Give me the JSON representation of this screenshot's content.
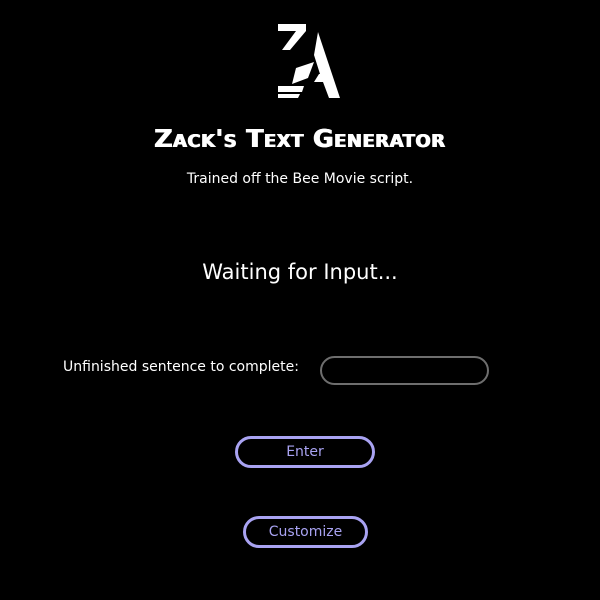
{
  "header": {
    "logo_icon": "za-monogram-logo",
    "title": "Zack's Text Generator",
    "subtitle": "Trained off the Bee Movie script."
  },
  "main": {
    "status": "Waiting for Input...",
    "prompt_label": "Unfinished sentence to complete:",
    "prompt_value": "",
    "enter_label": "Enter",
    "customize_label": "Customize"
  },
  "colors": {
    "background": "#000000",
    "text": "#ffffff",
    "accent": "#a9a3f2",
    "input_border": "#6e6e6e"
  }
}
